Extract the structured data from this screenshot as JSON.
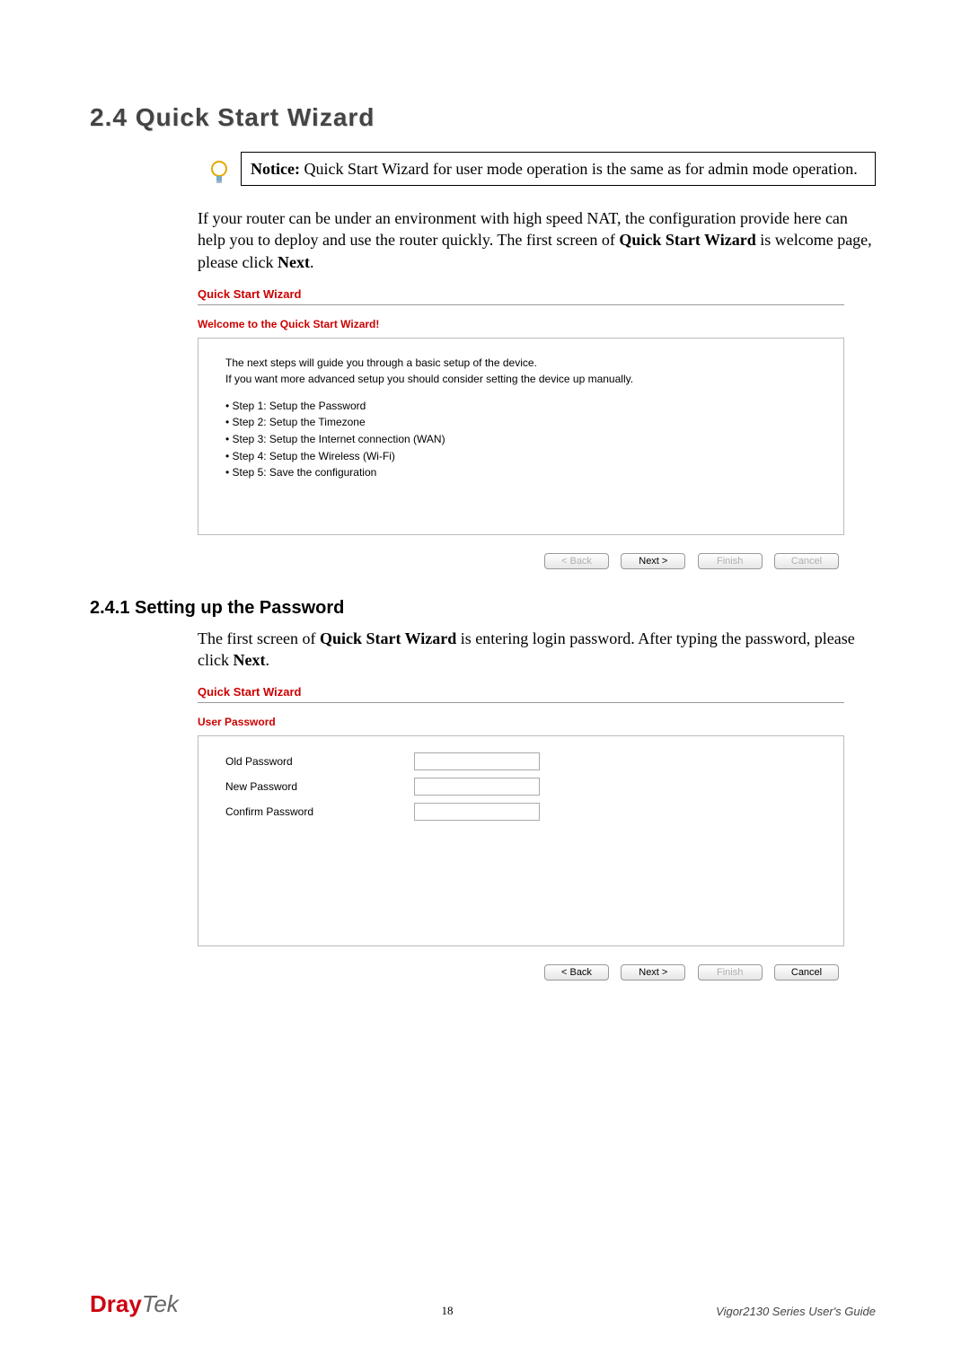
{
  "section": {
    "heading": "2.4 Quick Start Wizard",
    "sub_heading": "2.4.1 Setting up the Password"
  },
  "notice": {
    "label": "Notice:",
    "text": " Quick Start Wizard for user mode operation is the same as for admin mode operation."
  },
  "intro_para": {
    "pre": "If your router can be under an environment with high speed NAT, the configuration provide here can help you to deploy and use the router quickly. The first screen of ",
    "bold1": "Quick Start Wizard",
    "mid": " is welcome page, please click ",
    "bold2": "Next",
    "post": "."
  },
  "pw_para": {
    "pre": "The first screen of ",
    "bold1": "Quick Start Wizard",
    "mid": " is entering login password. After typing the password, please click ",
    "bold2": "Next",
    "post": "."
  },
  "wizard1": {
    "title": "Quick Start Wizard",
    "subtitle": "Welcome to the Quick Start Wizard!",
    "intro_line1": "The next steps will guide you through a basic setup of the device.",
    "intro_line2": "If you want more advanced setup you should consider setting the device up manually.",
    "steps": [
      "Step 1: Setup the Password",
      "Step 2: Setup the Timezone",
      "Step 3: Setup the Internet connection (WAN)",
      "Step 4: Setup the Wireless (Wi-Fi)",
      "Step 5: Save the configuration"
    ],
    "buttons": {
      "back": "< Back",
      "next": "Next >",
      "finish": "Finish",
      "cancel": "Cancel"
    }
  },
  "wizard2": {
    "title": "Quick Start Wizard",
    "subtitle": "User Password",
    "fields": {
      "old": "Old Password",
      "new": "New Password",
      "confirm": "Confirm Password"
    },
    "buttons": {
      "back": "< Back",
      "next": "Next >",
      "finish": "Finish",
      "cancel": "Cancel"
    }
  },
  "footer": {
    "brand_left": "Dray",
    "brand_right": "Tek",
    "page_num": "18",
    "guide": "Vigor2130 Series User's Guide"
  }
}
